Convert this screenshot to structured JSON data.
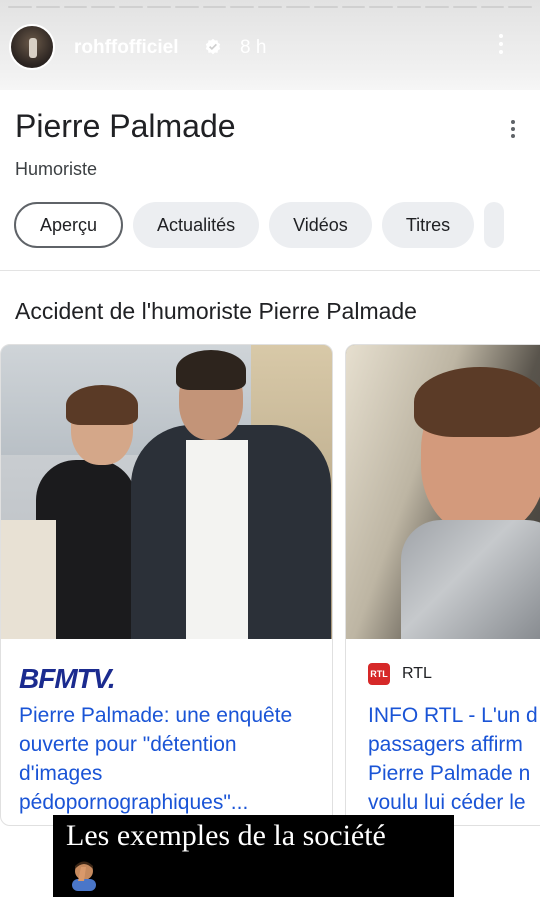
{
  "story": {
    "username": "rohffofficiel",
    "time": "8 h",
    "caption": "Les exemples de la société",
    "caption_emoji": "facepalm-emoji"
  },
  "panel": {
    "title": "Pierre Palmade",
    "subtitle": "Humoriste",
    "tabs": [
      {
        "label": "Aperçu",
        "active": true
      },
      {
        "label": "Actualités",
        "active": false
      },
      {
        "label": "Vidéos",
        "active": false
      },
      {
        "label": "Titres",
        "active": false
      }
    ],
    "section_title": "Accident de l'humoriste Pierre Palmade"
  },
  "cards": [
    {
      "source": "BFMTV.",
      "headline": "Pierre Palmade: une enquête ouverte pour \"détention d'images pédopornographiques\"..."
    },
    {
      "source_icon": "RTL",
      "source": "RTL",
      "headline_lines": [
        "INFO RTL - L'un d",
        "passagers affirm",
        "Pierre Palmade n",
        "voulu lui céder le"
      ]
    }
  ],
  "colors": {
    "link": "#1a54d6",
    "bfm": "#1b2b8f",
    "rtl": "#d62828"
  }
}
